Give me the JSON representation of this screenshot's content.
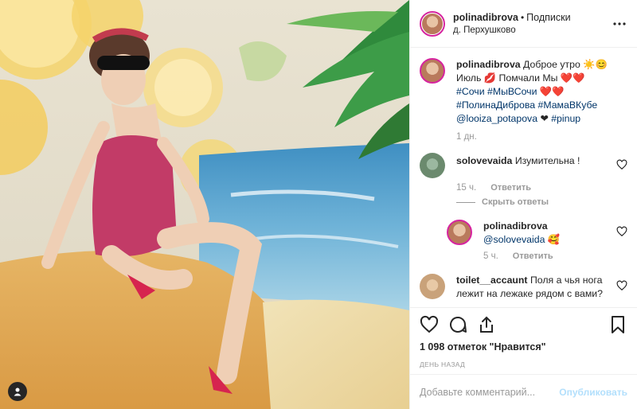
{
  "post": {
    "author": "polinadibrova",
    "dot": "•",
    "follow_label": "Подписки",
    "location": "д. Перхушково"
  },
  "caption": {
    "author": "polinadibrova",
    "segments": [
      {
        "text": " Доброе утро ☀️😊 Июль 💋 Помчали Мы ❤️❤️ ",
        "tag": false
      },
      {
        "text": "#Сочи",
        "tag": true
      },
      {
        "text": " ",
        "tag": false
      },
      {
        "text": "#МыВСочи",
        "tag": true
      },
      {
        "text": " ❤️❤️ ",
        "tag": false
      },
      {
        "text": "#ПолинаДиброва",
        "tag": true
      },
      {
        "text": " ",
        "tag": false
      },
      {
        "text": "#МамаВКубе",
        "tag": true
      },
      {
        "text": " ",
        "tag": false
      },
      {
        "text": "@looiza_potapova",
        "tag": true
      },
      {
        "text": " ❤ ",
        "tag": false
      },
      {
        "text": "#pinup",
        "tag": true
      }
    ],
    "time": "1 дн."
  },
  "comments": [
    {
      "user": "solovevaida",
      "text": "Изумительна !",
      "time": "15 ч.",
      "reply_label": "Ответить",
      "avatar_color": "#6b8a6e"
    },
    {
      "hide_replies": "Скрыть ответы"
    },
    {
      "user": "polinadibrova",
      "mention": "@solovevaida",
      "emoji": "🥰",
      "time": "5 ч.",
      "reply_label": "Ответить"
    },
    {
      "user": "toilet__accaunt",
      "text": "Поля а чья нога лежит на лежаке рядом с вами?",
      "avatar_color": "#c9a27a"
    }
  ],
  "likes_text": "1 098 отметок \"Нравится\"",
  "date_text": "ДЕНЬ НАЗАД",
  "comment_box": {
    "placeholder": "Добавьте комментарий...",
    "post_label": "Опубликовать"
  },
  "colors": {
    "accent_link": "#003569",
    "muted": "#999999",
    "post_button_disabled": "#b2dffc",
    "story_ring": "#d6249f"
  },
  "icons": [
    "heart-icon",
    "comment-icon",
    "share-icon",
    "bookmark-icon",
    "more-icon",
    "user-tag-icon"
  ]
}
